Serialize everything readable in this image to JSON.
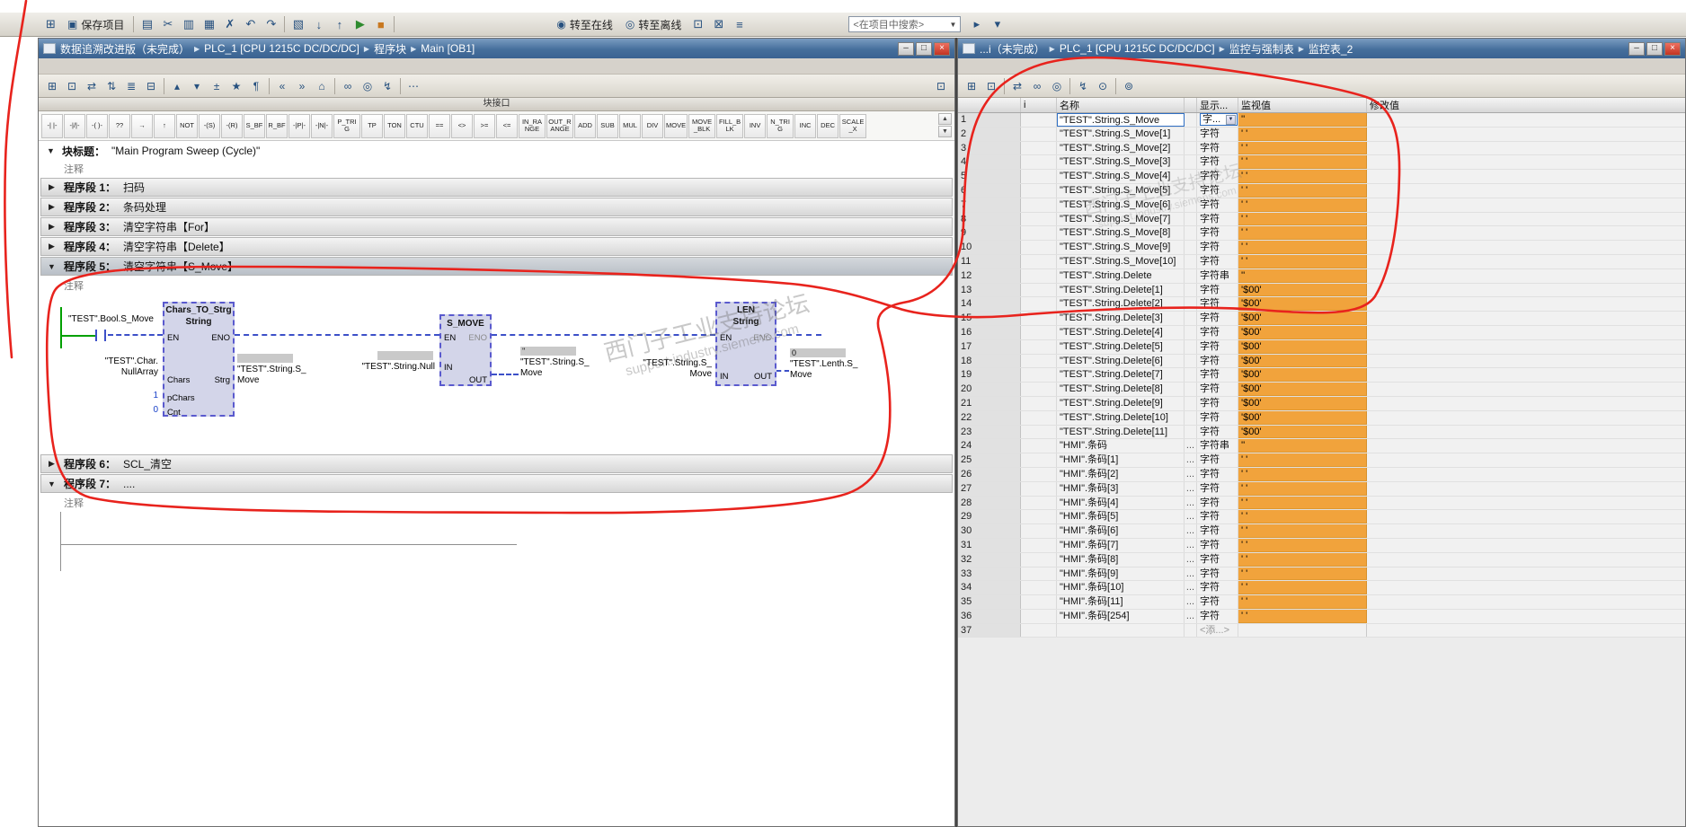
{
  "main_toolbar": {
    "search_placeholder": "<在项目中搜索>",
    "items": [
      {
        "name": "menu-grid-icon",
        "glyph": "⊞"
      },
      {
        "name": "save-project-button",
        "label": "保存项目",
        "glyph": "▣"
      },
      {
        "sep": true
      },
      {
        "name": "print-icon",
        "glyph": "▤"
      },
      {
        "name": "cut-icon",
        "glyph": "✂"
      },
      {
        "name": "copy-icon",
        "glyph": "▥"
      },
      {
        "name": "paste-icon",
        "glyph": "▦"
      },
      {
        "name": "delete-icon",
        "glyph": "✗"
      },
      {
        "name": "undo-icon",
        "glyph": "↶"
      },
      {
        "name": "redo-icon",
        "glyph": "↷"
      },
      {
        "sep": true
      },
      {
        "name": "compile-icon",
        "glyph": "▧"
      },
      {
        "name": "download-to-device-icon",
        "glyph": "↓"
      },
      {
        "name": "upload-from-device-icon",
        "glyph": "↑"
      },
      {
        "name": "start-cpu-icon",
        "glyph": "▶",
        "color": "#2e8b2e"
      },
      {
        "name": "stop-cpu-icon",
        "glyph": "■",
        "color": "#c87820"
      },
      {
        "sep": true
      },
      {
        "space": true
      },
      {
        "name": "go-online-button",
        "label": "转至在线",
        "glyph": "◉"
      },
      {
        "name": "go-offline-button",
        "label": "转至离线",
        "glyph": "◎"
      },
      {
        "name": "diagnostics-icon",
        "glyph": "⊡"
      },
      {
        "name": "cross-reference-icon",
        "glyph": "⊠"
      },
      {
        "name": "show-split-editor-icon",
        "glyph": "≡"
      }
    ],
    "trailing_icons": [
      {
        "name": "start-simulation-icon",
        "glyph": "▸"
      },
      {
        "name": "project-library-icon",
        "glyph": "▾"
      }
    ]
  },
  "editor": {
    "breadcrumbs": [
      "数据追溯改进版（未完成）",
      "PLC_1 [CPU 1215C DC/DC/DC]",
      "程序块",
      "Main [OB1]"
    ],
    "toolbar_items": [
      {
        "name": "insert-network-icon",
        "glyph": "⊞"
      },
      {
        "name": "insert-empty-box-icon",
        "glyph": "⊡"
      },
      {
        "name": "open-branch-icon",
        "glyph": "⇄"
      },
      {
        "name": "close-branch-icon",
        "glyph": "⇅"
      },
      {
        "name": "insert-row-icon",
        "glyph": "≣"
      },
      {
        "name": "delete-row-icon",
        "glyph": "⊟"
      },
      {
        "sep": true
      },
      {
        "name": "collapse-networks-icon",
        "glyph": "▴"
      },
      {
        "name": "expand-networks-icon",
        "glyph": "▾"
      },
      {
        "name": "absolute-symbolic-icon",
        "glyph": "±"
      },
      {
        "name": "favorites-icon",
        "glyph": "★"
      },
      {
        "name": "network-comments-icon",
        "glyph": "¶"
      },
      {
        "sep": true
      },
      {
        "name": "previous-error-icon",
        "glyph": "«"
      },
      {
        "name": "next-error-icon",
        "glyph": "»"
      },
      {
        "name": "go-to-definition-icon",
        "glyph": "⌂"
      },
      {
        "sep": true
      },
      {
        "name": "monitoring-glasses-icon",
        "glyph": "∞"
      },
      {
        "name": "snapshot-values-icon",
        "glyph": "◎"
      },
      {
        "name": "modify-value-icon",
        "glyph": "↯"
      },
      {
        "sep": true
      },
      {
        "name": "more-options-icon",
        "glyph": "⋯"
      }
    ],
    "split_editor_icon_glyph": "⊡",
    "block_interface_label": "块接口",
    "favorites": [
      {
        "name": "no-contact",
        "label": "-| |-"
      },
      {
        "name": "nc-contact",
        "label": "-|/|-"
      },
      {
        "name": "coil",
        "label": "-( )-"
      },
      {
        "name": "empty-box",
        "label": "??"
      },
      {
        "name": "open-branch",
        "label": "→"
      },
      {
        "name": "close-branch",
        "label": "↑"
      },
      {
        "name": "not",
        "label": "NOT"
      },
      {
        "name": "set-coil",
        "label": "-(S)"
      },
      {
        "name": "reset-coil",
        "label": "-(R)"
      },
      {
        "name": "set-bitfield",
        "label": "S_BF"
      },
      {
        "name": "reset-bitfield",
        "label": "R_BF"
      },
      {
        "name": "p-contact",
        "label": "-|P|-"
      },
      {
        "name": "n-contact",
        "label": "-|N|-"
      },
      {
        "name": "p-trig",
        "label": "P_TRIG"
      },
      {
        "name": "tp",
        "label": "TP"
      },
      {
        "name": "ton",
        "label": "TON"
      },
      {
        "name": "ctu",
        "label": "CTU"
      },
      {
        "name": "cmp-eq",
        "label": "=="
      },
      {
        "name": "cmp-ne",
        "label": "<>"
      },
      {
        "name": "cmp-ge",
        "label": ">="
      },
      {
        "name": "cmp-le",
        "label": "<="
      },
      {
        "name": "in-range",
        "label": "IN_RANGE"
      },
      {
        "name": "out-range",
        "label": "OUT_RANGE"
      },
      {
        "name": "add",
        "label": "ADD"
      },
      {
        "name": "sub",
        "label": "SUB"
      },
      {
        "name": "mul",
        "label": "MUL"
      },
      {
        "name": "div",
        "label": "DIV"
      },
      {
        "name": "move",
        "label": "MOVE"
      },
      {
        "name": "move-blk",
        "label": "MOVE_BLK"
      },
      {
        "name": "fill-blk",
        "label": "FILL_BLK"
      },
      {
        "name": "inv",
        "label": "INV"
      },
      {
        "name": "n-trig",
        "label": "N_TRIG"
      },
      {
        "name": "inc",
        "label": "INC"
      },
      {
        "name": "dec",
        "label": "DEC"
      },
      {
        "name": "scale-x",
        "label": "SCALE_X"
      }
    ],
    "block_title_label": "块标题：",
    "block_title_text": "\"Main Program Sweep (Cycle)\"",
    "comment_label": "注释",
    "networks": [
      {
        "label": "程序段 1：",
        "title": "扫码"
      },
      {
        "label": "程序段 2：",
        "title": "条码处理"
      },
      {
        "label": "程序段 3：",
        "title": "清空字符串【For】"
      },
      {
        "label": "程序段 4：",
        "title": "清空字符串【Delete】"
      },
      {
        "label": "程序段 5：",
        "title": "清空字符串【S_Move】"
      },
      {
        "label": "程序段 6：",
        "title": "SCL_清空"
      },
      {
        "label": "程序段 7：",
        "title": "...."
      }
    ],
    "ladder": {
      "contact": {
        "operand": "\"TEST\".Bool.S_Move"
      },
      "blocks": {
        "chars_to_strg": {
          "title": "Chars_TO_Strg",
          "subtitle": "String",
          "pin_en": "EN",
          "pin_eno": "ENO",
          "pin_chars": "Chars",
          "pin_pchars": "pChars",
          "pin_cnt": "Cnt",
          "pin_strg": "Strg",
          "pchars_value": "1",
          "cnt_value": "0",
          "input_operand_line1": "\"TEST\".Char.",
          "input_operand_line2": "NullArray",
          "output_monitor": "",
          "output_operand_line1": "\"TEST\".String.S_",
          "output_operand_line2": "Move"
        },
        "s_move": {
          "title": "S_MOVE",
          "pin_en": "EN",
          "pin_eno": "ENO",
          "pin_in": "IN",
          "pin_out": "OUT",
          "input_monitor": "",
          "input_operand_line1": "\"TEST\".String.Null",
          "output_monitor": "''",
          "output_operand_line1": "\"TEST\".String.S_",
          "output_operand_line2": "Move"
        },
        "len": {
          "title": "LEN",
          "subtitle": "String",
          "pin_en": "EN",
          "pin_eno": "ENO",
          "pin_in": "IN",
          "pin_out": "OUT",
          "input_operand_line1": "\"TEST\".String.S_",
          "input_operand_line2": "Move",
          "output_monitor": "0",
          "output_operand_line1": "\"TEST\".Lenth.S_",
          "output_operand_line2": "Move"
        }
      }
    }
  },
  "watch": {
    "breadcrumbs": [
      "...i（未完成）",
      "PLC_1 [CPU 1215C DC/DC/DC]",
      "监控与强制表",
      "监控表_2"
    ],
    "toolbar_items": [
      {
        "name": "insert-row-icon",
        "glyph": "⊞"
      },
      {
        "name": "add-row-icon",
        "glyph": "⊡"
      },
      {
        "sep": true
      },
      {
        "name": "show-modify-columns-icon",
        "glyph": "⇄"
      },
      {
        "name": "monitor-all-icon",
        "glyph": "∞"
      },
      {
        "name": "monitor-once-icon",
        "glyph": "◎"
      },
      {
        "sep": true
      },
      {
        "name": "modify-all-values-icon",
        "glyph": "↯"
      },
      {
        "name": "modify-once-icon",
        "glyph": "⊙"
      },
      {
        "sep": true
      },
      {
        "name": "enable-peripheral-outputs-icon",
        "glyph": "⊚"
      }
    ],
    "columns": {
      "num": "",
      "i": "i",
      "name": "名称",
      "dots": "",
      "fmt": "显示...",
      "monitor": "监视值",
      "modify": "修改值"
    },
    "rows": [
      {
        "num": 1,
        "name": "\"TEST\".String.S_Move",
        "fmt": "字...",
        "monitor": "''",
        "editing": true
      },
      {
        "num": 2,
        "name": "\"TEST\".String.S_Move[1]",
        "fmt": "字符",
        "monitor": "' '"
      },
      {
        "num": 3,
        "name": "\"TEST\".String.S_Move[2]",
        "fmt": "字符",
        "monitor": "' '"
      },
      {
        "num": 4,
        "name": "\"TEST\".String.S_Move[3]",
        "fmt": "字符",
        "monitor": "' '"
      },
      {
        "num": 5,
        "name": "\"TEST\".String.S_Move[4]",
        "fmt": "字符",
        "monitor": "' '"
      },
      {
        "num": 6,
        "name": "\"TEST\".String.S_Move[5]",
        "fmt": "字符",
        "monitor": "' '"
      },
      {
        "num": 7,
        "name": "\"TEST\".String.S_Move[6]",
        "fmt": "字符",
        "monitor": "' '"
      },
      {
        "num": 8,
        "name": "\"TEST\".String.S_Move[7]",
        "fmt": "字符",
        "monitor": "' '"
      },
      {
        "num": 9,
        "name": "\"TEST\".String.S_Move[8]",
        "fmt": "字符",
        "monitor": "' '"
      },
      {
        "num": 10,
        "name": "\"TEST\".String.S_Move[9]",
        "fmt": "字符",
        "monitor": "' '"
      },
      {
        "num": 11,
        "name": "\"TEST\".String.S_Move[10]",
        "fmt": "字符",
        "monitor": "' '"
      },
      {
        "num": 12,
        "name": "\"TEST\".String.Delete",
        "fmt": "字符串",
        "monitor": "''"
      },
      {
        "num": 13,
        "name": "\"TEST\".String.Delete[1]",
        "fmt": "字符",
        "monitor": "'$00'"
      },
      {
        "num": 14,
        "name": "\"TEST\".String.Delete[2]",
        "fmt": "字符",
        "monitor": "'$00'"
      },
      {
        "num": 15,
        "name": "\"TEST\".String.Delete[3]",
        "fmt": "字符",
        "monitor": "'$00'"
      },
      {
        "num": 16,
        "name": "\"TEST\".String.Delete[4]",
        "fmt": "字符",
        "monitor": "'$00'"
      },
      {
        "num": 17,
        "name": "\"TEST\".String.Delete[5]",
        "fmt": "字符",
        "monitor": "'$00'"
      },
      {
        "num": 18,
        "name": "\"TEST\".String.Delete[6]",
        "fmt": "字符",
        "monitor": "'$00'"
      },
      {
        "num": 19,
        "name": "\"TEST\".String.Delete[7]",
        "fmt": "字符",
        "monitor": "'$00'"
      },
      {
        "num": 20,
        "name": "\"TEST\".String.Delete[8]",
        "fmt": "字符",
        "monitor": "'$00'"
      },
      {
        "num": 21,
        "name": "\"TEST\".String.Delete[9]",
        "fmt": "字符",
        "monitor": "'$00'"
      },
      {
        "num": 22,
        "name": "\"TEST\".String.Delete[10]",
        "fmt": "字符",
        "monitor": "'$00'"
      },
      {
        "num": 23,
        "name": "\"TEST\".String.Delete[11]",
        "fmt": "字符",
        "monitor": "'$00'"
      },
      {
        "num": 24,
        "name": "\"HMI\".条码",
        "dots": true,
        "fmt": "字符串",
        "monitor": "''"
      },
      {
        "num": 25,
        "name": "\"HMI\".条码[1]",
        "dots": true,
        "fmt": "字符",
        "monitor": "' '"
      },
      {
        "num": 26,
        "name": "\"HMI\".条码[2]",
        "dots": true,
        "fmt": "字符",
        "monitor": "' '"
      },
      {
        "num": 27,
        "name": "\"HMI\".条码[3]",
        "dots": true,
        "fmt": "字符",
        "monitor": "' '"
      },
      {
        "num": 28,
        "name": "\"HMI\".条码[4]",
        "dots": true,
        "fmt": "字符",
        "monitor": "' '"
      },
      {
        "num": 29,
        "name": "\"HMI\".条码[5]",
        "dots": true,
        "fmt": "字符",
        "monitor": "' '"
      },
      {
        "num": 30,
        "name": "\"HMI\".条码[6]",
        "dots": true,
        "fmt": "字符",
        "monitor": "' '"
      },
      {
        "num": 31,
        "name": "\"HMI\".条码[7]",
        "dots": true,
        "fmt": "字符",
        "monitor": "' '"
      },
      {
        "num": 32,
        "name": "\"HMI\".条码[8]",
        "dots": true,
        "fmt": "字符",
        "monitor": "' '"
      },
      {
        "num": 33,
        "name": "\"HMI\".条码[9]",
        "dots": true,
        "fmt": "字符",
        "monitor": "' '"
      },
      {
        "num": 34,
        "name": "\"HMI\".条码[10]",
        "dots": true,
        "fmt": "字符",
        "monitor": "' '"
      },
      {
        "num": 35,
        "name": "\"HMI\".条码[11]",
        "dots": true,
        "fmt": "字符",
        "monitor": "' '"
      },
      {
        "num": 36,
        "name": "\"HMI\".条码[254]",
        "dots": true,
        "fmt": "字符",
        "monitor": "' '"
      },
      {
        "num": 37,
        "name": "",
        "fmt": "",
        "monitor": "",
        "placeholder": "<添...>"
      }
    ]
  },
  "watermark": {
    "line1": "西门子工业支持论坛",
    "line2": "support.industry.siemens.com"
  },
  "colors": {
    "titlebar": "#466f9c",
    "monitor_column": "#f1a33c",
    "annotation_red": "#e8231d",
    "rail_green": "#00a000",
    "wire_blue": "#3c50c8"
  }
}
